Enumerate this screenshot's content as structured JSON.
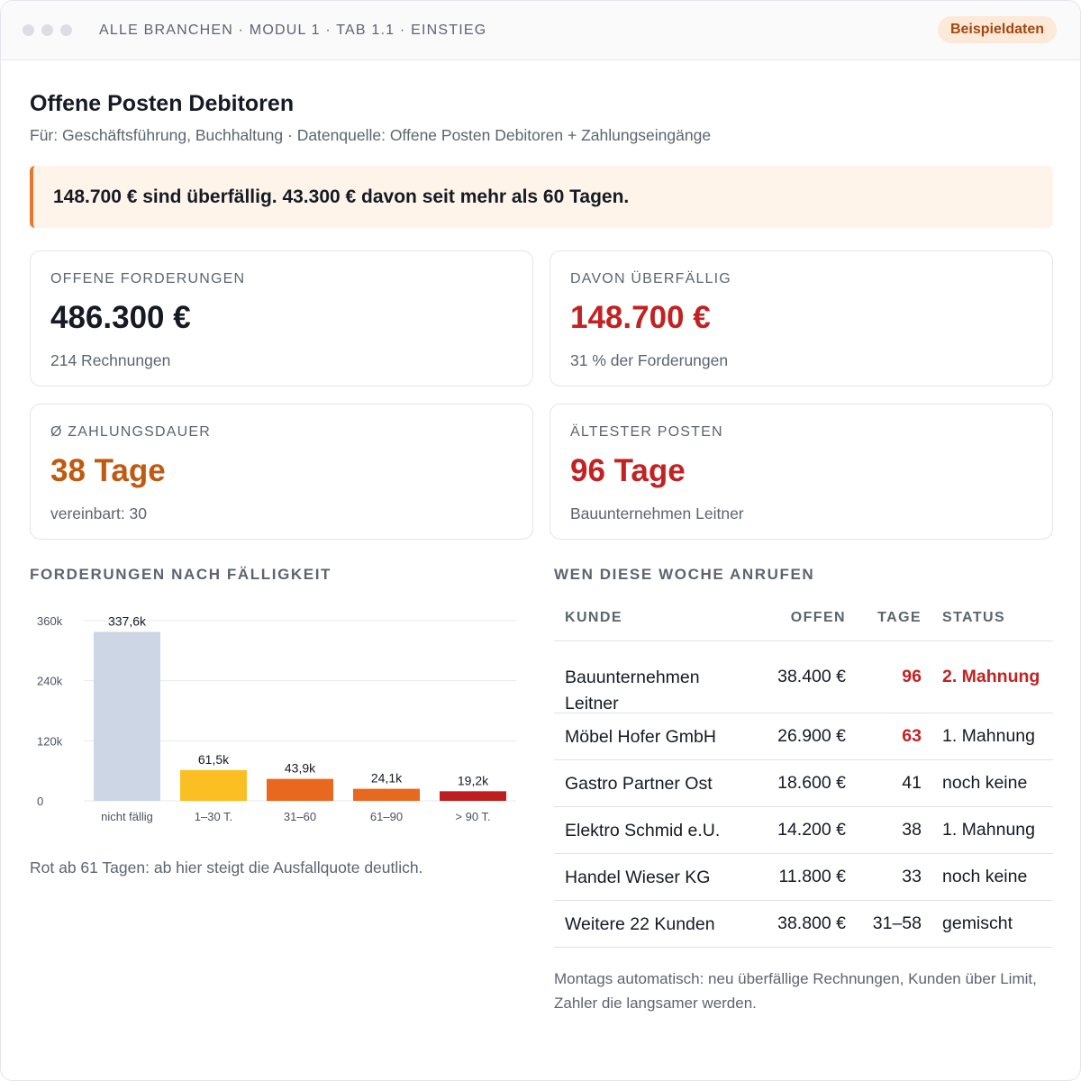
{
  "header": {
    "breadcrumb": "ALLE BRANCHEN · MODUL 1 · TAB 1.1 · EINSTIEG",
    "badge": "Beispieldaten"
  },
  "page": {
    "title": "Offene Posten Debitoren",
    "subtitle": "Für: Geschäftsführung, Buchhaltung · Datenquelle: Offene Posten Debitoren + Zahlungseingänge",
    "alert": "148.700 € sind überfällig. 43.300 € davon seit mehr als 60 Tagen."
  },
  "kpis": [
    {
      "label": "OFFENE FORDERUNGEN",
      "value": "486.300 €",
      "sub": "214 Rechnungen",
      "color": "#151a24"
    },
    {
      "label": "DAVON ÜBERFÄLLIG",
      "value": "148.700 €",
      "sub": "31 % der Forderungen",
      "color": "#c22222"
    },
    {
      "label": "Ø ZAHLUNGSDAUER",
      "value": "38 Tage",
      "sub": "vereinbart: 30",
      "color": "#c05a10"
    },
    {
      "label": "ÄLTESTER POSTEN",
      "value": "96 Tage",
      "sub": "Bauunternehmen Leitner",
      "color": "#c22222"
    }
  ],
  "chart_section": {
    "heading": "FORDERUNGEN NACH FÄLLIGKEIT",
    "note": "Rot ab 61 Tagen: ab hier steigt die Ausfallquote deutlich."
  },
  "chart_data": {
    "type": "bar",
    "categories": [
      "nicht fällig",
      "1–30 T.",
      "31–60",
      "61–90",
      "> 90 T."
    ],
    "values": [
      337.6,
      61.5,
      43.9,
      24.1,
      19.2
    ],
    "value_labels": [
      "337,6k",
      "61,5k",
      "43,9k",
      "24,1k",
      "19,2k"
    ],
    "bar_colors": [
      "#ccd6e4",
      "#fbbf24",
      "#e8681f",
      "#e8681f",
      "#bf1e1e"
    ],
    "yticks": [
      0,
      120,
      240,
      360
    ],
    "ytick_labels": [
      "0",
      "120k",
      "240k",
      "360k"
    ],
    "ylim": [
      0,
      360
    ],
    "grid": true
  },
  "table": {
    "heading": "WEN DIESE WOCHE ANRUFEN",
    "columns": [
      "KUNDE",
      "OFFEN",
      "TAGE",
      "STATUS"
    ],
    "rows": [
      {
        "kunde": "Bauunternehmen Leitner",
        "offen": "38.400 €",
        "tage": "96",
        "status": "2. Mahnung",
        "tage_red": true,
        "status_red": true
      },
      {
        "kunde": "Möbel Hofer GmbH",
        "offen": "26.900 €",
        "tage": "63",
        "status": "1. Mahnung",
        "tage_red": true,
        "status_red": false
      },
      {
        "kunde": "Gastro Partner Ost",
        "offen": "18.600 €",
        "tage": "41",
        "status": "noch keine",
        "tage_red": false,
        "status_red": false
      },
      {
        "kunde": "Elektro Schmid e.U.",
        "offen": "14.200 €",
        "tage": "38",
        "status": "1. Mahnung",
        "tage_red": false,
        "status_red": false
      },
      {
        "kunde": "Handel Wieser KG",
        "offen": "11.800 €",
        "tage": "33",
        "status": "noch keine",
        "tage_red": false,
        "status_red": false
      },
      {
        "kunde": "Weitere 22 Kunden",
        "offen": "38.800 €",
        "tage": "31–58",
        "status": "gemischt",
        "tage_red": false,
        "status_red": false
      }
    ],
    "footnote": "Montags automatisch: neu überfällige Rechnungen, Kunden über Limit, Zahler die langsamer werden."
  }
}
